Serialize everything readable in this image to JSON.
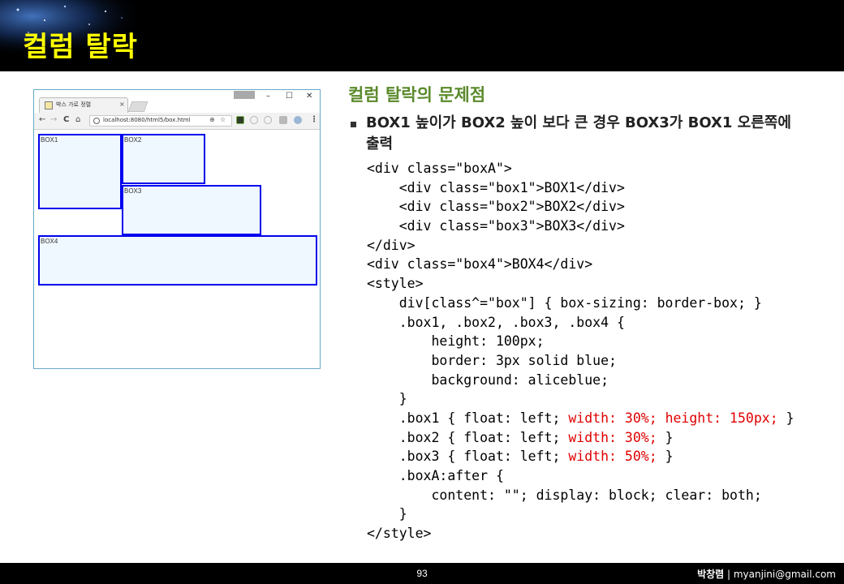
{
  "slide": {
    "title": "컬럼 탈락",
    "heading": "컬럼 탈락의 문제점",
    "bullet": "BOX1 높이가 BOX2 높이 보다 큰 경우 BOX3가 BOX1 오른쪽에 출력",
    "colors": {
      "title": "#ffff00",
      "heading": "#5b8a2c",
      "code_highlight": "#e00000",
      "box_border": "#0000ee",
      "box_fill": "#f0f8ff"
    }
  },
  "browser": {
    "tab_title": "박스 가로 정렬",
    "tab_close": "×",
    "badge": "",
    "url": "localhost:8080/html5/box.html",
    "controls": {
      "minimize": "–",
      "maximize": "☐",
      "close": "✕"
    },
    "nav": {
      "back": "←",
      "forward": "→",
      "reload": "C",
      "home": "⌂",
      "menu": "⋮"
    },
    "omni": {
      "zoom": "⊕",
      "star": "☆"
    },
    "boxes": [
      {
        "label": "BOX1"
      },
      {
        "label": "BOX2"
      },
      {
        "label": "BOX3"
      },
      {
        "label": "BOX4"
      }
    ]
  },
  "code": {
    "l1": "<div class=\"boxA\">",
    "l2": "    <div class=\"box1\">BOX1</div>",
    "l3": "    <div class=\"box2\">BOX2</div>",
    "l4": "    <div class=\"box3\">BOX3</div>",
    "l5": "</div>",
    "l6": "<div class=\"box4\">BOX4</div>",
    "l7": "<style>",
    "l8": "    div[class^=\"box\"] { box-sizing: border-box; }",
    "l9": "    .box1, .box2, .box3, .box4 {",
    "l10": "        height: 100px;",
    "l11": "        border: 3px solid blue;",
    "l12": "        background: aliceblue;",
    "l13": "    }",
    "l14a": "    .box1 { float: left; ",
    "l14b": "width: 30%; height: 150px;",
    "l14c": " }",
    "l15a": "    .box2 { float: left; ",
    "l15b": "width: 30%;",
    "l15c": " }",
    "l16a": "    .box3 { float: left; ",
    "l16b": "width: 50%;",
    "l16c": " }",
    "l17": "    .boxA:after {",
    "l18": "        content: \"\"; display: block; clear: both;",
    "l19": "    }",
    "l20": "</style>"
  },
  "footer": {
    "page": "93",
    "author": "박창렴",
    "separator": " | ",
    "email": "myanjini@gmail.com"
  }
}
